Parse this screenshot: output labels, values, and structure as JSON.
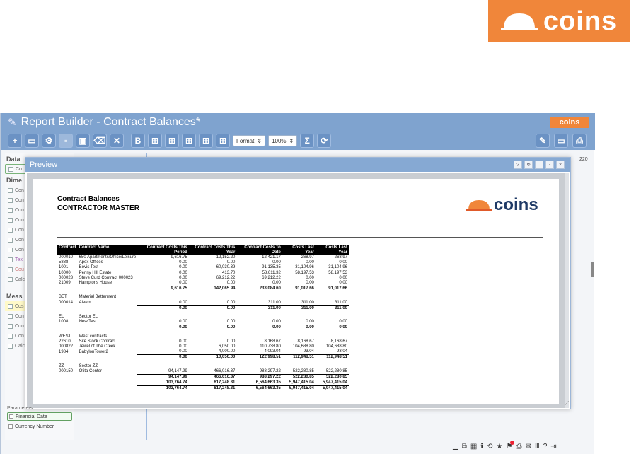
{
  "brand": {
    "word": "coins"
  },
  "window": {
    "title": "Report Builder - Contract Balances*",
    "mini_brand": "coins"
  },
  "toolbar": {
    "format_label": "Format",
    "zoom_label": "100%"
  },
  "left_panel": {
    "data_head": "Data",
    "data_item": "Co",
    "dimensions_head": "Dime",
    "dim_items": [
      "Con",
      "Con",
      "Con",
      "Con",
      "Con",
      "Con",
      "Con",
      "Tex",
      "Cou",
      "Calc"
    ],
    "measures_head": "Meas",
    "measure_items": [
      "Cos",
      "Con",
      "Con",
      "Con",
      "Calc"
    ]
  },
  "right_col": {
    "number": "220"
  },
  "preview": {
    "title": "Preview",
    "buttons": [
      "?",
      "↻",
      "–",
      "▫",
      "×"
    ]
  },
  "report": {
    "title": "Contract Balances",
    "subtitle": "CONTRACTOR MASTER",
    "logo_word": "coins",
    "headers": [
      "Contract",
      "Contract Name",
      "Contract Costs This Period",
      "Contract Costs This Year",
      "Contract Costs To Date",
      "Costs Last Year",
      "Costs Last Year"
    ],
    "groups": [
      {
        "rows": [
          [
            "000010",
            "650 Apartments/Office/Leisure",
            "9,616.75",
            "12,152.20",
            "12,421.17",
            "268.97",
            "268.97"
          ],
          [
            "5888",
            "Apex Offices",
            "0.00",
            "0.00",
            "0.00",
            "0.00",
            "0.00"
          ],
          [
            "1001",
            "Bovis Test",
            "0.00",
            "60,030.39",
            "91,135.35",
            "31,104.96",
            "31,104.96"
          ],
          [
            "10000",
            "Penny Hill Estate",
            "0.00",
            "413.70",
            "58,611.32",
            "58,197.53",
            "58,197.53"
          ],
          [
            "000023",
            "Steve Curd Contract 000023",
            "0.00",
            "69,212.22",
            "69,212.22",
            "0.00",
            "0.00"
          ],
          [
            "21009",
            "Hamptons House",
            "0.00",
            "0.00",
            "0.00",
            "0.00",
            "0.00"
          ]
        ],
        "total": [
          "9,616.75",
          "142,065.94",
          "233,084.60",
          "91,017.66",
          "91,017.66"
        ]
      },
      {
        "head": [
          "BET",
          "Material Betterment"
        ],
        "rows": [
          [
            "000014",
            "Aleem",
            "0.00",
            "0.00",
            "311.00",
            "311.00",
            "311.00"
          ]
        ],
        "total": [
          "0.00",
          "0.00",
          "311.00",
          "311.00",
          "311.00"
        ]
      },
      {
        "head": [
          "EL",
          "Sector EL"
        ],
        "rows": [
          [
            "1008",
            "New Test",
            "0.00",
            "0.00",
            "0.00",
            "0.00",
            "0.00"
          ]
        ],
        "total": [
          "0.00",
          "0.00",
          "0.00",
          "0.00",
          "0.00"
        ]
      },
      {
        "head": [
          "WEST",
          "West contracts"
        ],
        "rows": [
          [
            "22610",
            "Site Stock Contract",
            "0.00",
            "0.00",
            "8,168.67",
            "8,168.67",
            "8,168.67"
          ],
          [
            "000822",
            "Jewel of The Creek",
            "0.00",
            "6,050.00",
            "110,738.80",
            "104,688.80",
            "104,688.80"
          ],
          [
            "1984",
            "BabylonTower2",
            "0.00",
            "4,000.00",
            "4,093.04",
            "93.04",
            "93.04"
          ]
        ],
        "total": [
          "0.00",
          "10,050.00",
          "122,998.51",
          "112,948.51",
          "112,948.51"
        ]
      },
      {
        "head": [
          "ZZ",
          "Sector ZZ"
        ],
        "rows": [
          [
            "000150",
            "Ofita Center",
            "94,147.99",
            "466,016.37",
            "988,297.22",
            "522,280.85",
            "522,280.85"
          ]
        ],
        "total": [
          "94,147.99",
          "466,016.37",
          "988,297.22",
          "522,280.85",
          "522,280.85"
        ]
      }
    ],
    "grand_totals": [
      [
        "103,764.74",
        "617,248.31",
        "6,564,663.35",
        "5,947,415.04",
        "5,947,415.04"
      ],
      [
        "103,764.74",
        "617,248.31",
        "6,564,663.35",
        "5,947,415.04",
        "5,947,415.04"
      ]
    ]
  },
  "parameters": {
    "head": "Parameters",
    "items": [
      "Financial Date",
      "Currency Number"
    ]
  },
  "colors": {
    "brand_orange": "#f0863a",
    "titlebar_blue": "#7fa3cf",
    "report_logo_navy": "#1f3a66"
  }
}
